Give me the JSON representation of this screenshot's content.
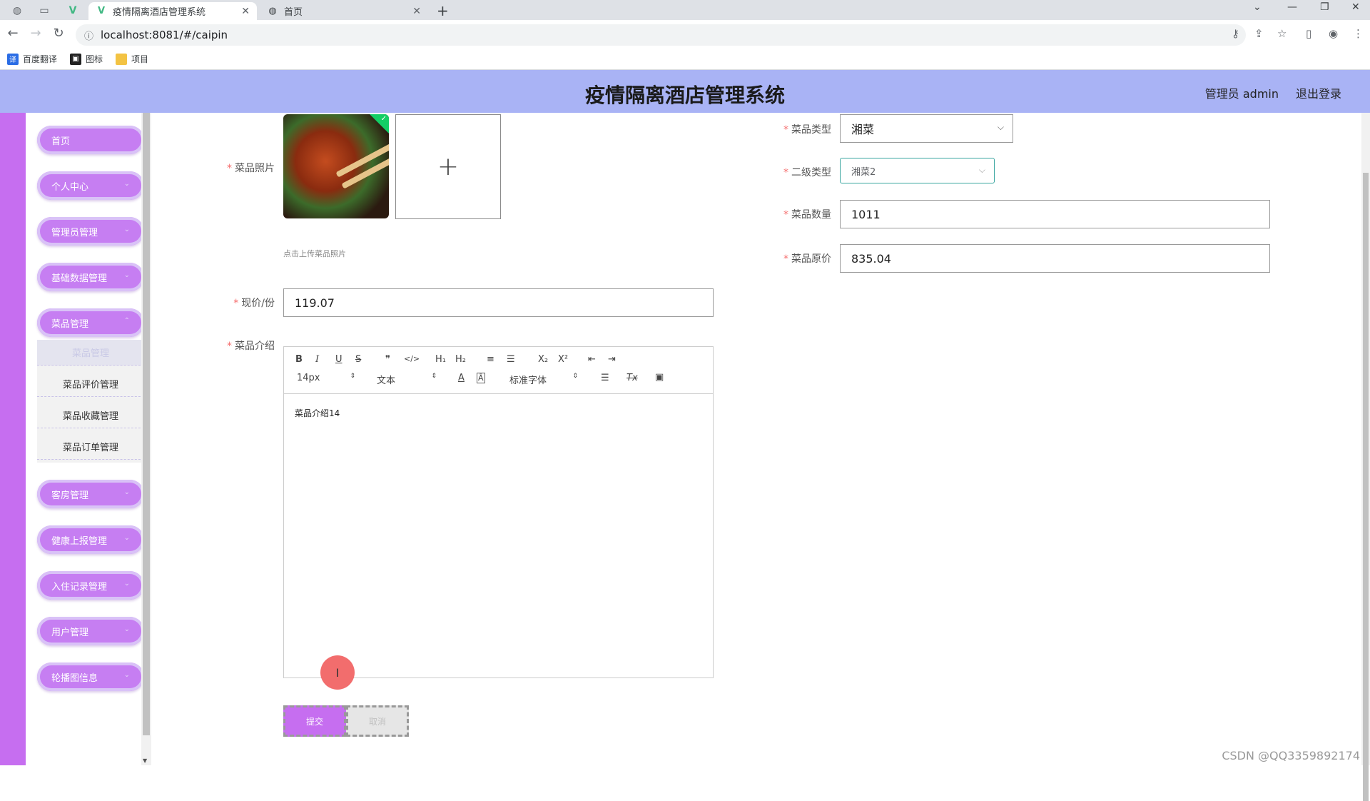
{
  "browser": {
    "tabs": [
      {
        "title": "疫情隔离酒店管理系统",
        "active": true
      },
      {
        "title": "首页",
        "active": false
      }
    ],
    "new_tab": "+",
    "url": "localhost:8081/#/caipin",
    "bookmarks": [
      {
        "label": "百度翻译",
        "color": "#2b6de5"
      },
      {
        "label": "图标",
        "color": "#222222"
      },
      {
        "label": "项目",
        "color": "#f3c343"
      }
    ]
  },
  "header": {
    "title": "疫情隔离酒店管理系统",
    "user": "管理员 admin",
    "logout": "退出登录",
    "color": "#a9b3f5"
  },
  "sidebar": {
    "accent": "#c66ef0",
    "items": [
      {
        "label": "首页"
      },
      {
        "label": "个人中心"
      },
      {
        "label": "管理员管理"
      },
      {
        "label": "基础数据管理"
      },
      {
        "label": "菜品管理"
      },
      {
        "label": "客房管理"
      },
      {
        "label": "健康上报管理"
      },
      {
        "label": "入住记录管理"
      },
      {
        "label": "用户管理"
      },
      {
        "label": "轮播图信息"
      }
    ],
    "sub_items": [
      {
        "label": "菜品管理",
        "active": true
      },
      {
        "label": "菜品评价管理"
      },
      {
        "label": "菜品收藏管理"
      },
      {
        "label": "菜品订单管理"
      }
    ]
  },
  "form": {
    "photo_label": "菜品照片",
    "upload_hint": "点击上传菜品照片",
    "upload_plus": "+",
    "price_label": "现价/份",
    "price_value": "119.07",
    "intro_label": "菜品介绍",
    "category_label": "菜品类型",
    "category_value": "湘菜",
    "subcategory_label": "二级类型",
    "subcategory_value": "湘菜2",
    "quantity_label": "菜品数量",
    "quantity_value": "1011",
    "original_price_label": "菜品原价",
    "original_price_value": "835.04",
    "required_mark": "*"
  },
  "editor": {
    "toolbar": {
      "bold": "B",
      "italic": "I",
      "underline": "U",
      "strike": "S",
      "quote": "❞",
      "code": "</>",
      "h1": "H₁",
      "h2": "H₂",
      "ordered_list": "≡",
      "bullet_list": "☰",
      "sub": "X₂",
      "sup": "X²",
      "outdent": "⇤",
      "indent": "⇥",
      "font_size": "14px",
      "header_select": "文本",
      "font_family": "标准字体",
      "color": "A",
      "background": "Ā",
      "align": "☰",
      "clean": "Tx",
      "image": "▣"
    },
    "content": "菜品介绍14"
  },
  "buttons": {
    "submit": "提交",
    "cancel": "取消"
  },
  "cursor_glyph": "I",
  "watermark": "CSDN @QQ3359892174"
}
